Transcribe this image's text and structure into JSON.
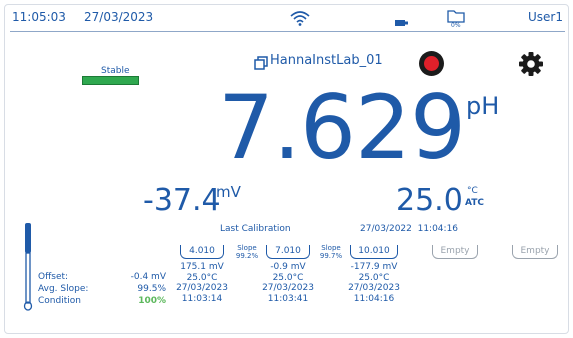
{
  "status_bar": {
    "time": "11:05:03",
    "date": "27/03/2023",
    "storage_percent": "0%",
    "user": "User1"
  },
  "stability": {
    "label": "Stable",
    "color": "#2fa84f"
  },
  "file_name": "HannaInstLab_01",
  "reading": {
    "ph_value": "7.629",
    "ph_unit": "pH",
    "mv_value": "-37.4",
    "mv_unit": "mV",
    "temp_value": "25.0",
    "temp_unit": "°C",
    "temp_mode": "ATC"
  },
  "calibration": {
    "title": "Last Calibration",
    "datetime": "27/03/2022  11:04:16",
    "stats": [
      {
        "label": "Offset:",
        "value": "-0.4 mV"
      },
      {
        "label": "Avg. Slope:",
        "value": "99.5%"
      },
      {
        "label": "Condition",
        "value": "100%"
      }
    ],
    "condition_color": "#5cb85c",
    "buffers": [
      {
        "value": "4.010",
        "mv": "175.1 mV",
        "temp": "25.0°C",
        "date": "27/03/2023",
        "time": "11:03:14"
      },
      {
        "value": "7.010",
        "mv": "-0.9 mV",
        "temp": "25.0°C",
        "date": "27/03/2023",
        "time": "11:03:41"
      },
      {
        "value": "10.010",
        "mv": "-177.9 mV",
        "temp": "25.0°C",
        "date": "27/03/2023",
        "time": "11:04:16"
      }
    ],
    "slopes": [
      {
        "label": "Slope",
        "value": "99.2%"
      },
      {
        "label": "Slope",
        "value": "99.7%"
      }
    ],
    "empty_slots": [
      "Empty",
      "Empty"
    ]
  },
  "icons": {
    "wifi": "wifi-icon",
    "battery": "battery-plug-icon",
    "folder": "folder-icon",
    "files": "file-copy-icon",
    "record": "record-icon",
    "settings": "gear-icon",
    "electrode": "electrode-icon"
  },
  "colors": {
    "primary_blue": "#1f5aa8",
    "record_red": "#e0202a"
  }
}
